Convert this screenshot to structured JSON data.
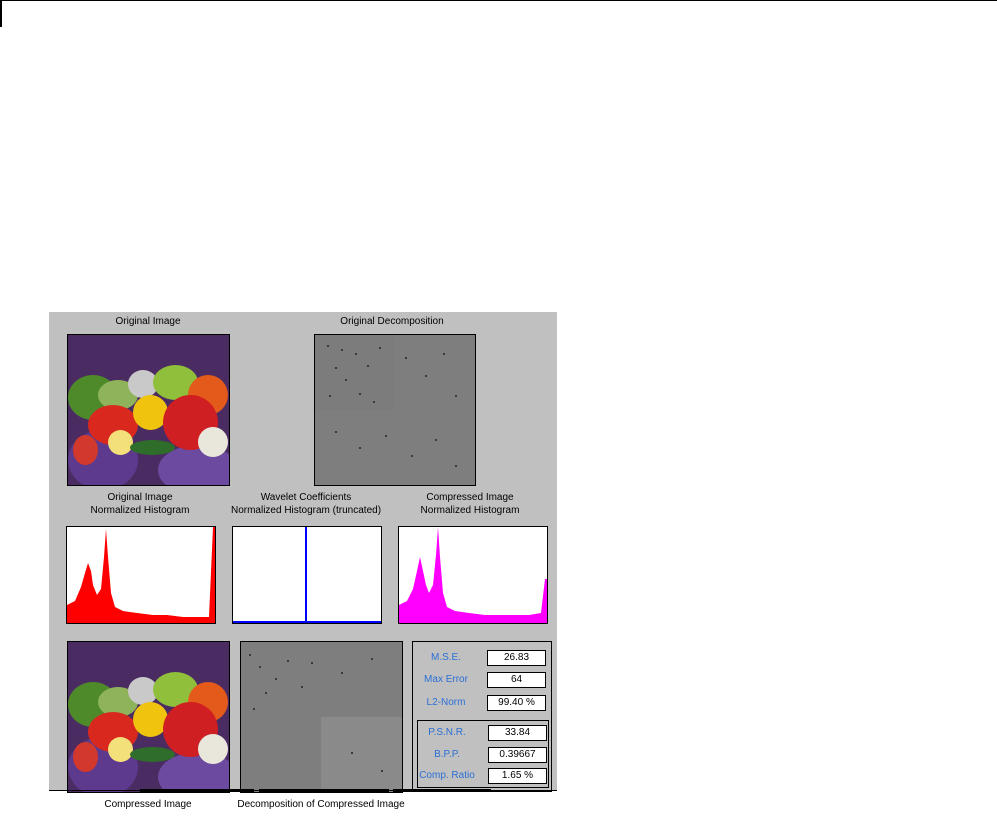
{
  "titles": {
    "original_image": "Original Image",
    "original_decomposition": "Original Decomposition",
    "compressed_image": "Compressed Image",
    "decomposition_compressed": "Decomposition of Compressed Image"
  },
  "histograms": {
    "original": {
      "line1": "Original Image",
      "line2": "Normalized Histogram",
      "color": "#ff0000"
    },
    "wavelet": {
      "line1": "Wavelet Coefficients",
      "line2": "Normalized Histogram (truncated)",
      "color": "#0000ff"
    },
    "compressed": {
      "line1": "Compressed Image",
      "line2": "Normalized Histogram",
      "color": "#ff00ff"
    }
  },
  "stats": {
    "mse": {
      "label": "M.S.E.",
      "value": "26.83"
    },
    "max_error": {
      "label": "Max Error",
      "value": "64"
    },
    "l2_norm": {
      "label": "L2-Norm",
      "value": "99.40 %"
    },
    "psnr": {
      "label": "P.S.N.R.",
      "value": "33.84"
    },
    "bpp": {
      "label": "B.P.P.",
      "value": "0.39667"
    },
    "comp_ratio": {
      "label": "Comp. Ratio",
      "value": "1.65 %"
    }
  }
}
